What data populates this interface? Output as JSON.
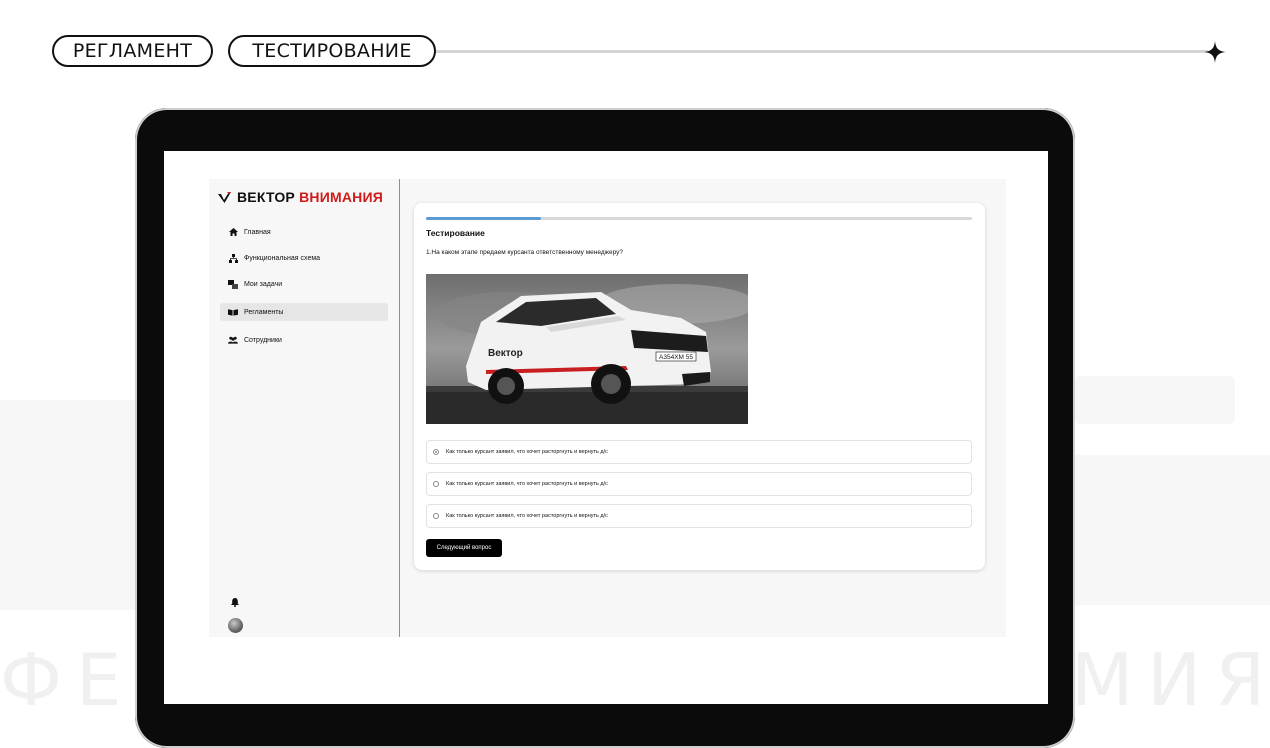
{
  "header": {
    "pill_1": "РЕГЛАМЕНТ",
    "pill_2": "ТЕСТИРОВАНИЕ"
  },
  "app": {
    "logo": {
      "word_dark": "ВЕКТОР",
      "word_red": "ВНИМАНИЯ"
    },
    "sidebar": {
      "items": [
        {
          "label": "Главная",
          "icon": "home-icon"
        },
        {
          "label": "Функциональная схема",
          "icon": "hierarchy-icon"
        },
        {
          "label": "Мои задачи",
          "icon": "tasks-icon"
        },
        {
          "label": "Регламенты",
          "icon": "book-icon",
          "active": true
        },
        {
          "label": "Сотрудники",
          "icon": "users-icon"
        }
      ],
      "bottom_icons": [
        "bell-icon",
        "avatar"
      ]
    },
    "test": {
      "progress_fraction": 0.21,
      "title": "Тестирование",
      "question": "1.На каком этапе предаем курсанта ответственному менеджеру?",
      "image_text": {
        "brand": "Вектор",
        "plate": "А354ХМ 55"
      },
      "options": [
        {
          "label": "Как только курсант заявил, что хочет расторгнуть и вернуть д/с",
          "checked": true
        },
        {
          "label": "Как только курсант заявил, что хочет расторгнуть и вернуть д/с",
          "checked": false
        },
        {
          "label": "Как только курсант заявил, что хочет расторгнуть и вернуть д/с",
          "checked": false
        }
      ],
      "next_button": "Следующий вопрос"
    }
  },
  "background": {
    "text": "ФЕДЕРАЛЬНАЯ АКАДЕМИЯ ВОЖДЕНИЯ"
  },
  "colors": {
    "accent_red": "#d11a1a",
    "progress_blue": "#5b9bd5",
    "button_black": "#000000"
  }
}
